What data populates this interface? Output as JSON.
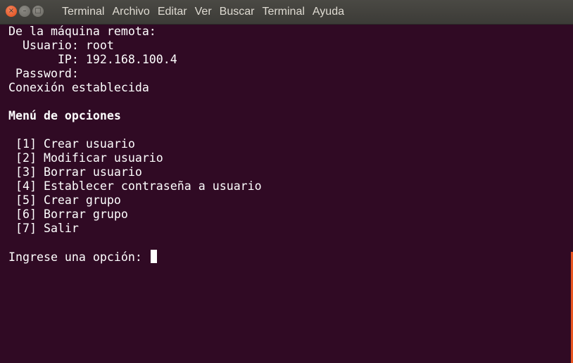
{
  "window": {
    "title": "Terminal",
    "buttons": {
      "close": "×",
      "minimize": "–",
      "maximize": "□"
    }
  },
  "menu": [
    "Archivo",
    "Editar",
    "Ver",
    "Buscar",
    "Terminal",
    "Ayuda"
  ],
  "terminal": {
    "remote_heading": "De la máquina remota:",
    "user_label": "  Usuario: root",
    "ip_label": "       IP: 192.168.100.4",
    "password_label": " Password:",
    "connection_status": "Conexión establecida",
    "menu_title": "Menú de opciones",
    "options": [
      " [1] Crear usuario",
      " [2] Modificar usuario",
      " [3] Borrar usuario",
      " [4] Establecer contraseña a usuario",
      " [5] Crear grupo",
      " [6] Borrar grupo",
      " [7] Salir"
    ],
    "prompt": "Ingrese una opción: "
  },
  "colors": {
    "background": "#300a24",
    "text": "#ffffff",
    "accent": "#e95420",
    "titlebar": "#3c3b37"
  }
}
